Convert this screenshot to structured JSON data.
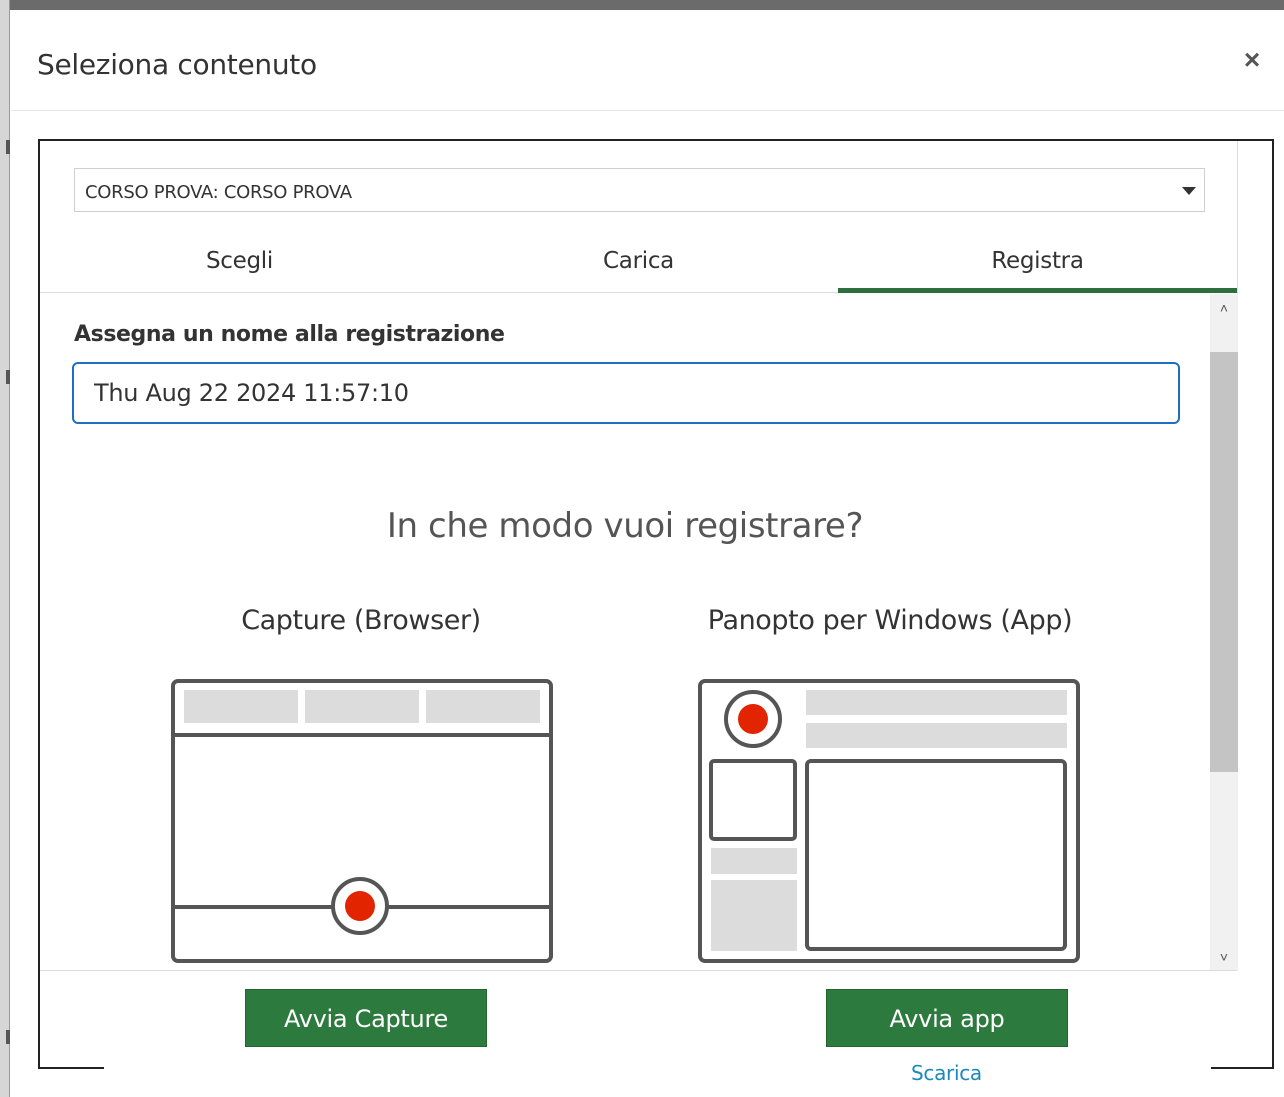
{
  "dialog": {
    "title": "Seleziona contenuto",
    "close_label": "×"
  },
  "folder_select": {
    "value": "CORSO PROVA: CORSO PROVA"
  },
  "tabs": [
    {
      "label": "Scegli",
      "active": false
    },
    {
      "label": "Carica",
      "active": false
    },
    {
      "label": "Registra",
      "active": true
    }
  ],
  "recording": {
    "name_label": "Assegna un nome alla registrazione",
    "name_value": "Thu Aug 22 2024 11:57:10",
    "question": "In che modo vuoi registrare?"
  },
  "options": {
    "capture": {
      "title": "Capture (Browser)",
      "button_label": "Avvia Capture",
      "icon": "browser-recording-illustration"
    },
    "app": {
      "title": "Panopto per Windows (App)",
      "button_label": "Avvia app",
      "download_label": "Scarica",
      "icon": "windows-app-recording-illustration"
    }
  },
  "scrollbar": {
    "up_icon": "chevron-up-icon",
    "down_icon": "chevron-down-icon"
  },
  "colors": {
    "accent_green": "#2d7a3e",
    "tab_underline": "#2d6e3e",
    "input_border": "#1f6fc0",
    "record_red": "#e22400",
    "link_blue": "#1a8ab8"
  }
}
